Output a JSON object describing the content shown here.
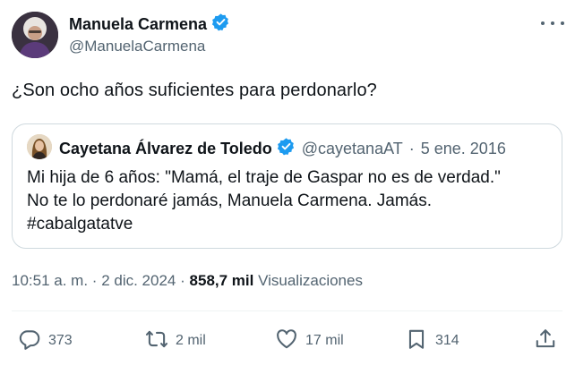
{
  "author": {
    "name": "Manuela Carmena",
    "handle": "@ManuelaCarmena",
    "verified": true
  },
  "tweet": {
    "text": "¿Son ocho años suficientes para perdonarlo?"
  },
  "quoted": {
    "name": "Cayetana Álvarez de Toledo",
    "handle": "@cayetanaAT",
    "separator": "·",
    "date": "5 ene. 2016",
    "verified": true,
    "lines": [
      "Mi hija de 6 años: \"Mamá, el traje de Gaspar no es de verdad.\"",
      "No te lo perdonaré jamás, Manuela Carmena. Jamás.",
      "#cabalgatatve"
    ]
  },
  "meta": {
    "time": "10:51 a. m.",
    "separator": "·",
    "date": "2 dic. 2024",
    "views_count": "858,7 mil",
    "views_label": "Visualizaciones"
  },
  "actions": {
    "replies": "373",
    "reposts": "2 mil",
    "likes": "17 mil",
    "bookmarks": "314"
  },
  "colors": {
    "verified": "#1d9bf0",
    "text": "#0f1419",
    "secondary": "#536471",
    "border": "#cfd9de"
  },
  "icons": {
    "verified": "verified-badge-icon",
    "more": "more-options-icon",
    "reply": "reply-icon",
    "repost": "repost-icon",
    "like": "heart-icon",
    "bookmark": "bookmark-icon",
    "share": "share-icon"
  }
}
